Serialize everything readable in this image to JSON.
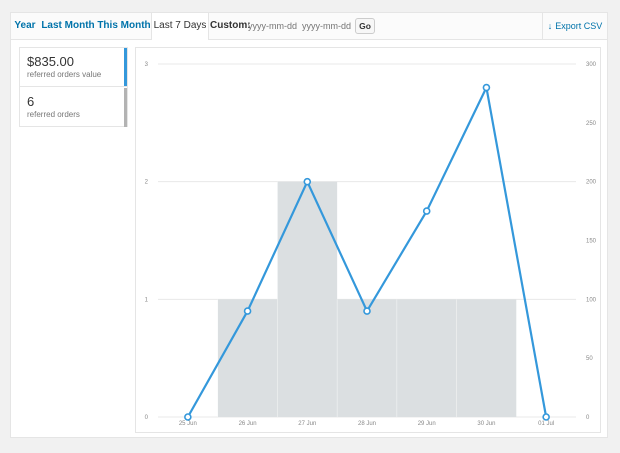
{
  "tabs": [
    {
      "label": "Year",
      "active": false
    },
    {
      "label": "Last Month",
      "active": false
    },
    {
      "label": "This Month",
      "active": false
    },
    {
      "label": "Last 7 Days",
      "active": true
    }
  ],
  "custom": {
    "label": "Custom:",
    "start_placeholder": "yyyy-mm-dd",
    "end_placeholder": "yyyy-mm-dd",
    "go_label": "Go"
  },
  "export": {
    "label": "Export CSV",
    "icon": "download-arrow-icon"
  },
  "legend": [
    {
      "value": "$835.00",
      "label": "referred orders value",
      "color": "#3498db"
    },
    {
      "value": "6",
      "label": "referred orders",
      "color": "#b3b3b3"
    }
  ],
  "colors": {
    "line": "#3498db",
    "bars": "#dbdfe1",
    "link": "#0073aa"
  },
  "chart_data": {
    "type": "bar",
    "categories": [
      "25 Jun",
      "26 Jun",
      "27 Jun",
      "28 Jun",
      "29 Jun",
      "30 Jun",
      "01 Jul"
    ],
    "series": [
      {
        "name": "referred orders",
        "type": "bar",
        "axis": "left",
        "values": [
          0,
          1,
          2,
          1,
          1,
          1,
          0
        ]
      },
      {
        "name": "referred orders value",
        "type": "line",
        "axis": "right",
        "values": [
          0,
          90,
          200,
          90,
          175,
          280,
          0
        ]
      }
    ],
    "y_left": {
      "ticks": [
        "0",
        "1",
        "2",
        "3"
      ],
      "ylim": [
        0,
        3
      ]
    },
    "y_right": {
      "ticks": [
        "0",
        "50",
        "100",
        "150",
        "200",
        "250",
        "300"
      ],
      "ylim": [
        0,
        300
      ]
    },
    "grid": true
  }
}
